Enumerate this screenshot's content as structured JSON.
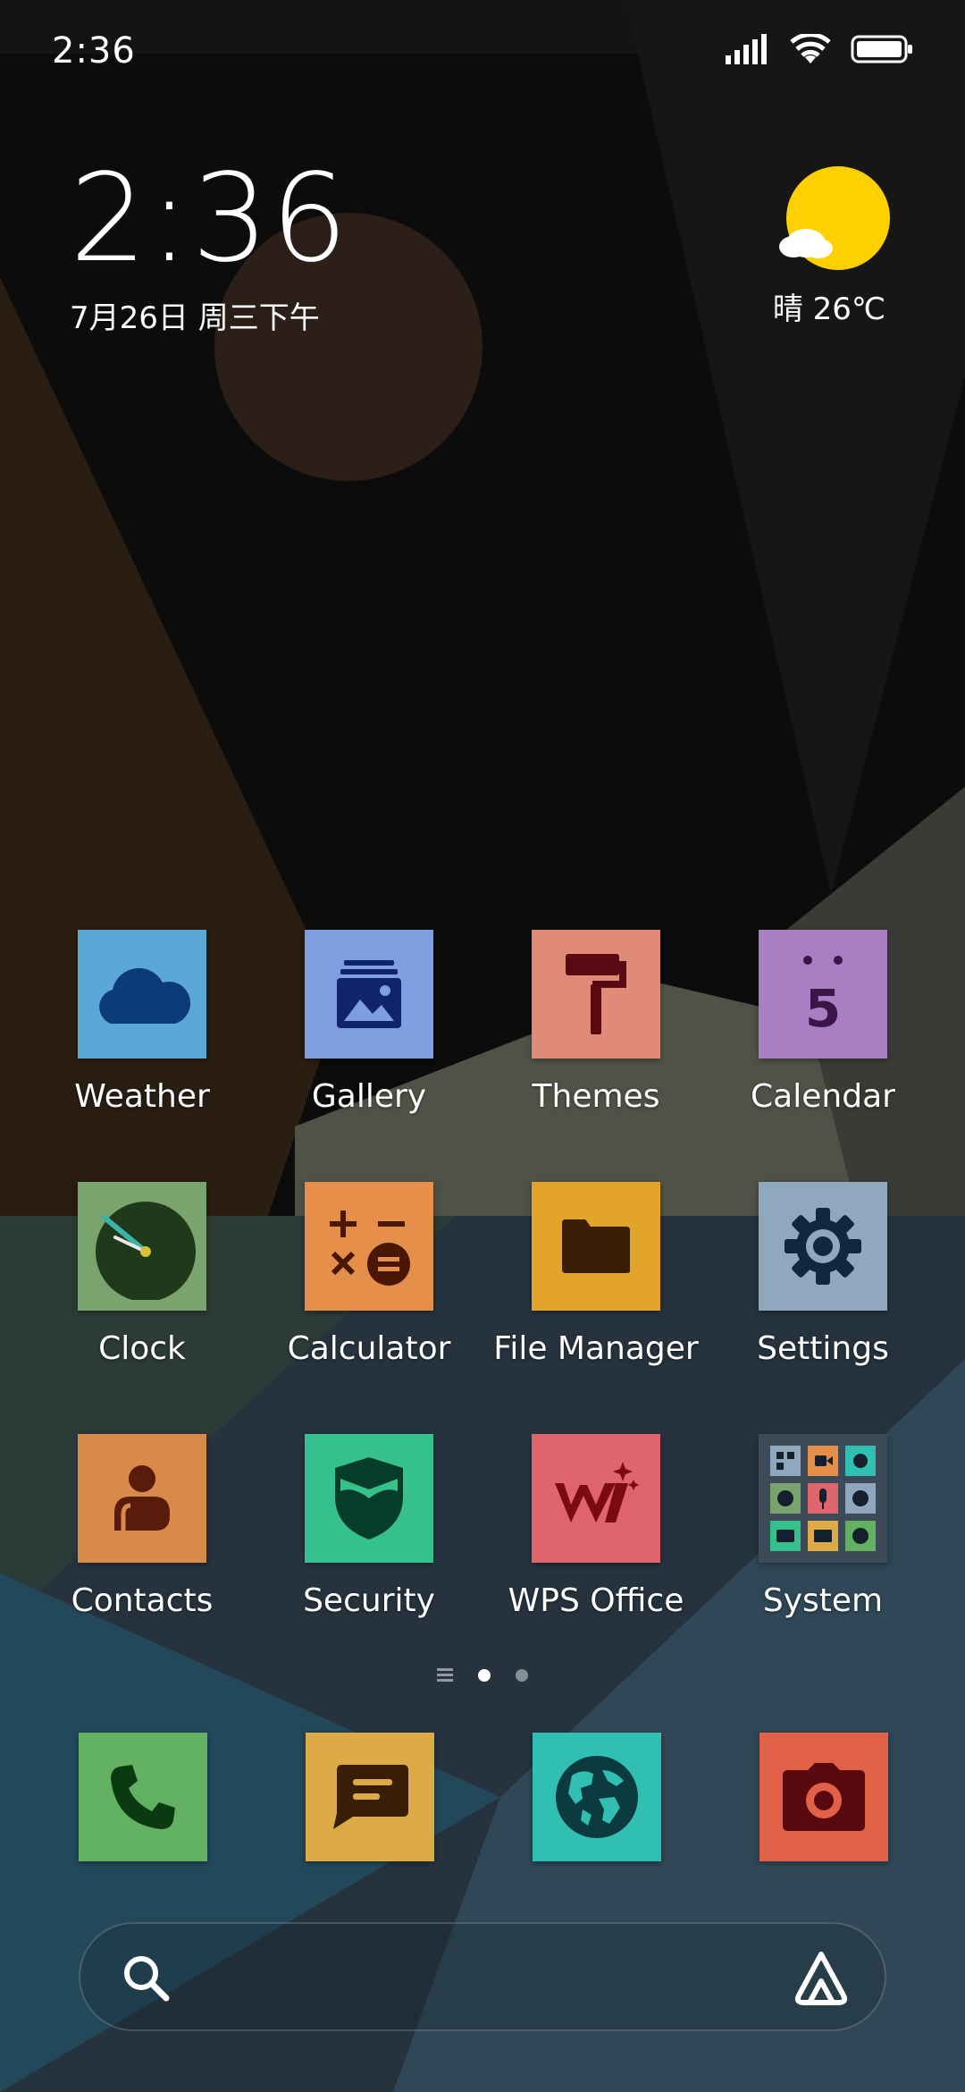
{
  "status_bar": {
    "time": "2:36",
    "icons": [
      "signal-icon",
      "wifi-icon",
      "battery-icon"
    ]
  },
  "clock_widget": {
    "time": "2:36",
    "date": "7月26日 周三下午"
  },
  "weather_widget": {
    "icon": "sunny-cloud-icon",
    "text": "晴 26℃"
  },
  "apps": [
    {
      "label": "Weather",
      "color": "#5aa8d6",
      "icon": "cloud-icon"
    },
    {
      "label": "Gallery",
      "color": "#7f9ee0",
      "icon": "gallery-icon"
    },
    {
      "label": "Themes",
      "color": "#e08a78",
      "icon": "paint-roller-icon"
    },
    {
      "label": "Calendar",
      "color": "#a77fc2",
      "icon": "calendar-icon",
      "badge": "5"
    },
    {
      "label": "Clock",
      "color": "#7aa46e",
      "icon": "clock-icon"
    },
    {
      "label": "Calculator",
      "color": "#e58f4a",
      "icon": "calculator-icon"
    },
    {
      "label": "File Manager",
      "color": "#e2a52a",
      "icon": "folder-icon"
    },
    {
      "label": "Settings",
      "color": "#8fa8bd",
      "icon": "gear-icon"
    },
    {
      "label": "Contacts",
      "color": "#d88a4a",
      "icon": "person-icon"
    },
    {
      "label": "Security",
      "color": "#35c08e",
      "icon": "shield-icon"
    },
    {
      "label": "WPS Office",
      "color": "#e0646b",
      "icon": "wps-icon"
    },
    {
      "label": "System",
      "color": "#3d4a57",
      "icon": "folder-grid-icon"
    }
  ],
  "dock": [
    {
      "name": "phone",
      "color": "#62b062",
      "icon": "phone-icon"
    },
    {
      "name": "messages",
      "color": "#dcaa47",
      "icon": "message-icon"
    },
    {
      "name": "browser",
      "color": "#30bfb2",
      "icon": "globe-icon"
    },
    {
      "name": "camera",
      "color": "#e06148",
      "icon": "camera-icon"
    }
  ],
  "page_indicator": {
    "pages": 2,
    "active": 0
  },
  "search": {
    "placeholder": ""
  }
}
